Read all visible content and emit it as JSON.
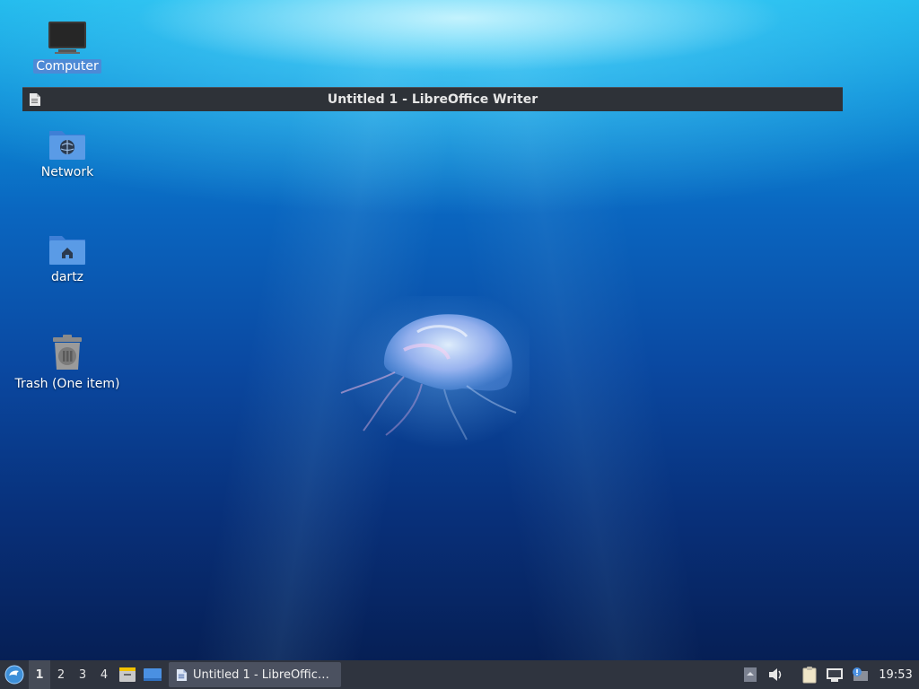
{
  "window": {
    "title": "Untitled 1 - LibreOffice Writer"
  },
  "desktop_icons": [
    {
      "label": "Computer",
      "icon": "computer-icon"
    },
    {
      "label": "Network",
      "icon": "network-folder-icon"
    },
    {
      "label": "dartz",
      "icon": "home-folder-icon"
    },
    {
      "label": "Trash (One item)",
      "icon": "trash-icon"
    }
  ],
  "taskbar": {
    "workspaces": [
      "1",
      "2",
      "3",
      "4"
    ],
    "active_workspace": "1",
    "task_label": "Untitled 1 - LibreOffic…",
    "clock": "19:53"
  },
  "colors": {
    "panel": "#2f343f",
    "selection": "#4d8ad6",
    "titlebar": "#2e3238"
  }
}
